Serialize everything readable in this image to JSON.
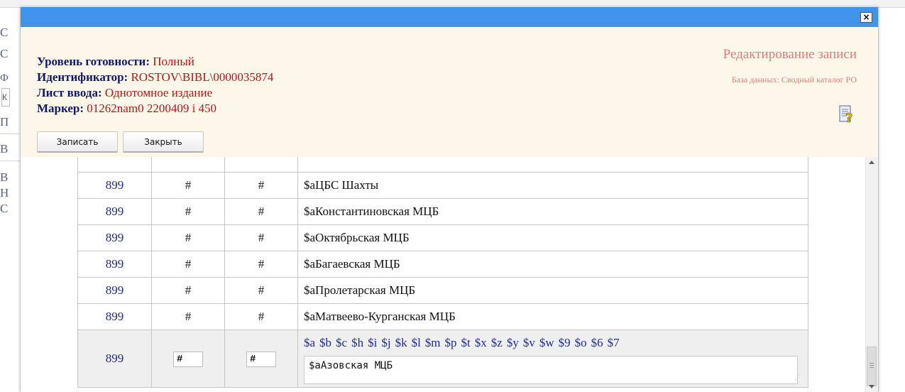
{
  "background": {
    "letters": [
      "С",
      "С",
      "Ф",
      "П",
      "В",
      "В",
      "Н",
      "С"
    ],
    "box_text": "К"
  },
  "dialog": {
    "close_label": "×",
    "info": {
      "level_label": "Уровень готовности:",
      "level_value": "Полный",
      "id_label": "Идентификатор:",
      "id_value": "ROSTOV\\BIBL\\0000035874",
      "sheet_label": "Лист ввода:",
      "sheet_value": "Однотомное издание",
      "marker_label": "Маркер:",
      "marker_value": "01262nam0 2200409 i 450"
    },
    "edit_title": "Редактирование записи",
    "db_label": "База данных: Сводный каталог РО",
    "help_icon": "help-book-question-icon",
    "buttons": {
      "save": "Записать",
      "close": "Закрыть"
    }
  },
  "fields": {
    "partial_row_text": "$аЦБС Шахты",
    "rows": [
      {
        "tag": "899",
        "ind1": "#",
        "ind2": "#",
        "data": "$аЦБС Шахты"
      },
      {
        "tag": "899",
        "ind1": "#",
        "ind2": "#",
        "data": "$аКонстантиновская МЦБ"
      },
      {
        "tag": "899",
        "ind1": "#",
        "ind2": "#",
        "data": "$аОктябрьская МЦБ"
      },
      {
        "tag": "899",
        "ind1": "#",
        "ind2": "#",
        "data": "$аБагаевская МЦБ"
      },
      {
        "tag": "899",
        "ind1": "#",
        "ind2": "#",
        "data": "$аПролетарская МЦБ"
      },
      {
        "tag": "899",
        "ind1": "#",
        "ind2": "#",
        "data": "$аМатвеево-Курганская МЦБ"
      }
    ],
    "edit_row": {
      "tag": "899",
      "ind1": "#",
      "ind2": "#",
      "subfields": [
        "$a",
        "$b",
        "$c",
        "$h",
        "$i",
        "$j",
        "$k",
        "$l",
        "$m",
        "$p",
        "$t",
        "$x",
        "$z",
        "$y",
        "$v",
        "$w",
        "$9",
        "$o",
        "$6",
        "$7"
      ],
      "value": "$аАзовская МЦБ"
    }
  },
  "colors": {
    "titlebar": "#4193ea",
    "header_bg": "#fdf7ea",
    "label_navy": "#101a66",
    "value_red": "#b31414",
    "title_pink": "#e07a7a",
    "tag_blue": "#1f2a80"
  }
}
